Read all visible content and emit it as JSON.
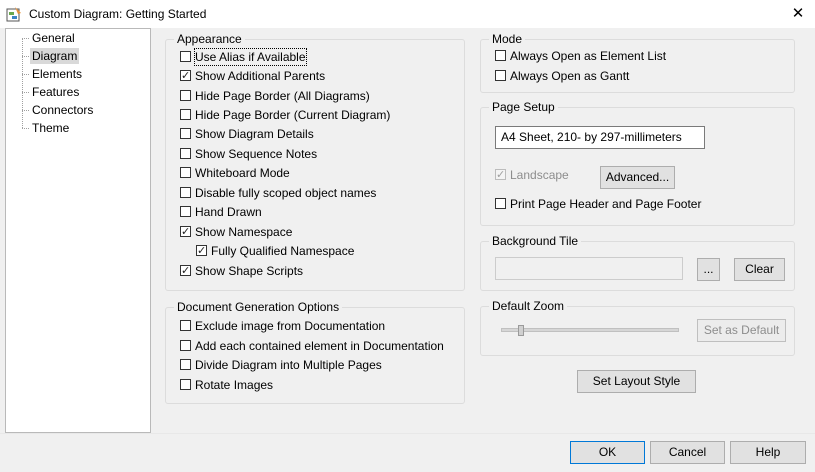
{
  "window": {
    "title": "Custom Diagram: Getting Started",
    "close_icon": "close-icon",
    "app_icon": "diagram-app-icon"
  },
  "tree": {
    "items": [
      {
        "label": "General",
        "selected": false
      },
      {
        "label": "Diagram",
        "selected": true
      },
      {
        "label": "Elements",
        "selected": false
      },
      {
        "label": "Features",
        "selected": false
      },
      {
        "label": "Connectors",
        "selected": false
      },
      {
        "label": "Theme",
        "selected": false
      }
    ]
  },
  "appearance": {
    "title": "Appearance",
    "options": [
      {
        "label": "Use Alias if Available",
        "checked": false
      },
      {
        "label": "Show Additional Parents",
        "checked": true
      },
      {
        "label": "Hide Page Border (All Diagrams)",
        "checked": false
      },
      {
        "label": "Hide Page Border (Current Diagram)",
        "checked": false
      },
      {
        "label": "Show Diagram Details",
        "checked": false
      },
      {
        "label": "Show Sequence Notes",
        "checked": false
      },
      {
        "label": "Whiteboard Mode",
        "checked": false
      },
      {
        "label": "Disable fully scoped object names",
        "checked": false
      },
      {
        "label": "Hand Drawn",
        "checked": false
      },
      {
        "label": "Show Namespace",
        "checked": true
      },
      {
        "label": "Fully Qualified Namespace",
        "checked": true
      },
      {
        "label": "Show Shape Scripts",
        "checked": true
      }
    ]
  },
  "docgen": {
    "title": "Document Generation Options",
    "options": [
      {
        "label": "Exclude image from Documentation",
        "checked": false
      },
      {
        "label": "Add each contained element in Documentation",
        "checked": false
      },
      {
        "label": "Divide Diagram into Multiple Pages",
        "checked": false
      },
      {
        "label": "Rotate Images",
        "checked": false
      }
    ]
  },
  "mode": {
    "title": "Mode",
    "options": [
      {
        "label": "Always Open as Element List",
        "checked": false
      },
      {
        "label": "Always Open as Gantt",
        "checked": false
      }
    ]
  },
  "page_setup": {
    "title": "Page Setup",
    "page_size": "A4 Sheet, 210- by 297-millimeters",
    "landscape_label": "Landscape",
    "landscape_checked": true,
    "advanced_button": "Advanced...",
    "print_header_label": "Print Page Header and Page Footer",
    "print_header_checked": false
  },
  "background_tile": {
    "title": "Background Tile",
    "value": "",
    "browse_button": "...",
    "clear_button": "Clear"
  },
  "default_zoom": {
    "title": "Default Zoom",
    "level": 0.1,
    "set_default_button": "Set as Default"
  },
  "layout_button": "Set Layout Style",
  "footer": {
    "ok": "OK",
    "cancel": "Cancel",
    "help": "Help"
  }
}
